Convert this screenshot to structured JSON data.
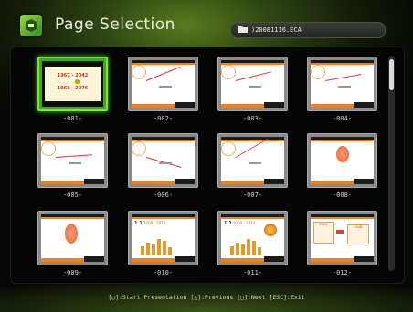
{
  "header": {
    "title": "Page Selection",
    "file_name": ")20081116.ECA",
    "app_icon": "presentation-app-icon",
    "folder_icon": "folder-icon"
  },
  "pages": [
    {
      "label": "-001-",
      "selected": true,
      "line1": "1967 - 2042",
      "line2": "1968 - 2076"
    },
    {
      "label": "-002-",
      "selected": false
    },
    {
      "label": "-003-",
      "selected": false
    },
    {
      "label": "-004-",
      "selected": false
    },
    {
      "label": "-005-",
      "selected": false
    },
    {
      "label": "-006-",
      "selected": false
    },
    {
      "label": "-007-",
      "selected": false
    },
    {
      "label": "-008-",
      "selected": false
    },
    {
      "label": "-009-",
      "selected": false
    },
    {
      "label": "-010-",
      "selected": false,
      "line1": "1.1",
      "line2": "2009 - 2012"
    },
    {
      "label": "-011-",
      "selected": false,
      "line1": "1.1",
      "line2": "2009 - 2012"
    },
    {
      "label": "-012-",
      "selected": false,
      "line1": "2003",
      "line2": "2048"
    }
  ],
  "footer": {
    "hint": "[○]:Start Presentation  [△]:Previous  [□]:Next  [ESC]:Exit"
  },
  "scrollbar": {
    "position": 0.0
  },
  "colors": {
    "accent": "#7fe348",
    "orange": "#f0821e",
    "background": "#050505"
  }
}
